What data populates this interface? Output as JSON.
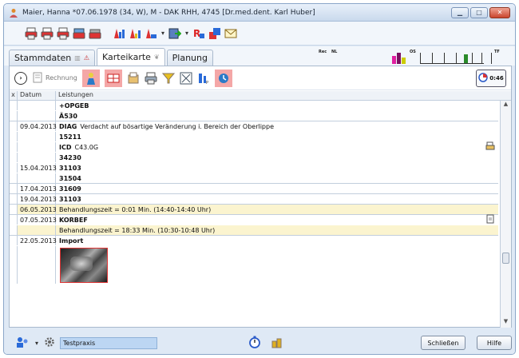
{
  "window": {
    "title": "Maier, Hanna  *07.06.1978 (34, W),  M - DAK RHH, 4745 [Dr.med.dent. Karl Huber]",
    "buttons": [
      "minimize",
      "maximize",
      "close"
    ]
  },
  "toolbar1": {
    "icons": [
      "printer-red-icon",
      "printer-red-icon",
      "printer-red-icon",
      "card-printer-icon",
      "fax-icon",
      "invoice-chart-icon",
      "invoice-chart-icon",
      "invoice-chart-icon",
      "export-icon",
      "report-icon",
      "stack-icon",
      "mail-icon"
    ]
  },
  "tabs": [
    {
      "label": "Stammdaten",
      "active": false
    },
    {
      "label": "Karteikarte",
      "active": true
    },
    {
      "label": "Planung",
      "active": false
    }
  ],
  "status_strip": {
    "labels": [
      "Rec",
      "NL",
      "OS",
      "TF"
    ],
    "colors": [
      "#e020a0",
      "#2a8a2a",
      "#cccc00"
    ]
  },
  "toolbar2": {
    "rechnung_label": "Rechnung",
    "timer_value": "0:46"
  },
  "grid": {
    "header": {
      "x": "x",
      "date": "Datum",
      "services": "Leistungen"
    },
    "rows": [
      {
        "date": "",
        "code": "+OPGEB",
        "text": "",
        "yellow": false
      },
      {
        "date": "",
        "code": "Ä530",
        "text": "",
        "yellow": false
      },
      {
        "date": "09.04.2013",
        "code": "DIAG",
        "text": "Verdacht auf bösartige Veränderung i. Bereich der Oberlippe",
        "yellow": false
      },
      {
        "date": "",
        "code": "15211",
        "text": "",
        "yellow": false
      },
      {
        "date": "",
        "code": "ICD",
        "text": "C43.0G",
        "yellow": false
      },
      {
        "date": "",
        "code": "34230",
        "text": "",
        "yellow": false
      },
      {
        "date": "15.04.2013",
        "code": "31103",
        "text": "",
        "yellow": false
      },
      {
        "date": "",
        "code": "31504",
        "text": "",
        "yellow": false
      },
      {
        "date": "17.04.2013",
        "code": "31609",
        "text": "",
        "yellow": false
      },
      {
        "date": "19.04.2013",
        "code": "31103",
        "text": "",
        "yellow": false
      },
      {
        "date": "06.05.2013",
        "code": "",
        "text": "Behandlungszeit = 0:01 Min. (14:40-14:40 Uhr)",
        "yellow": true
      },
      {
        "date": "07.05.2013",
        "code": "KORBEF",
        "text": "",
        "yellow": false
      },
      {
        "date": "",
        "code": "",
        "text": "Behandlungszeit = 18:33 Min. (10:30-10:48 Uhr)",
        "yellow": true
      },
      {
        "date": "22.05.2013",
        "code": "Import",
        "text": "",
        "yellow": false
      }
    ]
  },
  "bottom": {
    "praxis_value": "Testpraxis",
    "close_label": "Schließen",
    "help_label": "Hilfe"
  }
}
